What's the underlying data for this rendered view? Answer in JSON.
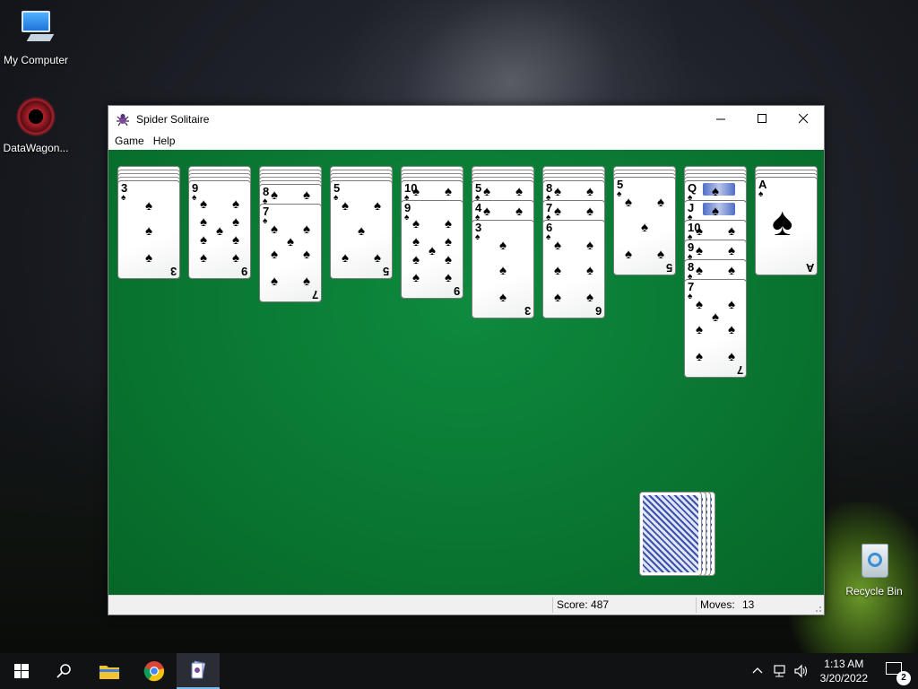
{
  "desktop": {
    "icons": [
      {
        "label": "My Computer",
        "icon": "computer-icon"
      },
      {
        "label": "DataWagon...",
        "icon": "datawagon-icon"
      },
      {
        "label": "Recycle Bin",
        "icon": "recycle-bin-icon"
      }
    ]
  },
  "window": {
    "title": "Spider Solitaire",
    "menu": [
      "Game",
      "Help"
    ],
    "buttons": [
      "minimize",
      "maximize",
      "close"
    ],
    "felt_color": "#0a7a34"
  },
  "game": {
    "suit_symbol": "♠",
    "columns": [
      {
        "face_down": 4,
        "face_up": [
          "3"
        ]
      },
      {
        "face_down": 4,
        "face_up": [
          "9"
        ]
      },
      {
        "face_down": 5,
        "face_up": [
          "8",
          "7"
        ]
      },
      {
        "face_down": 4,
        "face_up": [
          "5"
        ]
      },
      {
        "face_down": 4,
        "face_up": [
          "10",
          "9"
        ]
      },
      {
        "face_down": 4,
        "face_up": [
          "5",
          "4",
          "3"
        ]
      },
      {
        "face_down": 4,
        "face_up": [
          "8",
          "7",
          "6"
        ]
      },
      {
        "face_down": 3,
        "face_up": [
          "5"
        ]
      },
      {
        "face_down": 4,
        "face_up": [
          "Q",
          "J",
          "10",
          "9",
          "8",
          "7"
        ]
      },
      {
        "face_down": 3,
        "face_up": [
          "A"
        ]
      }
    ],
    "stock_piles": 4
  },
  "status": {
    "score_label": "Score: 487",
    "moves_label": "Moves:",
    "moves_value": "13"
  },
  "taskbar": {
    "items": [
      "start-icon",
      "search-icon",
      "file-explorer-icon",
      "chrome-icon",
      "spider-solitaire-icon"
    ],
    "time": "1:13 AM",
    "date": "3/20/2022",
    "notification_count": "2"
  }
}
